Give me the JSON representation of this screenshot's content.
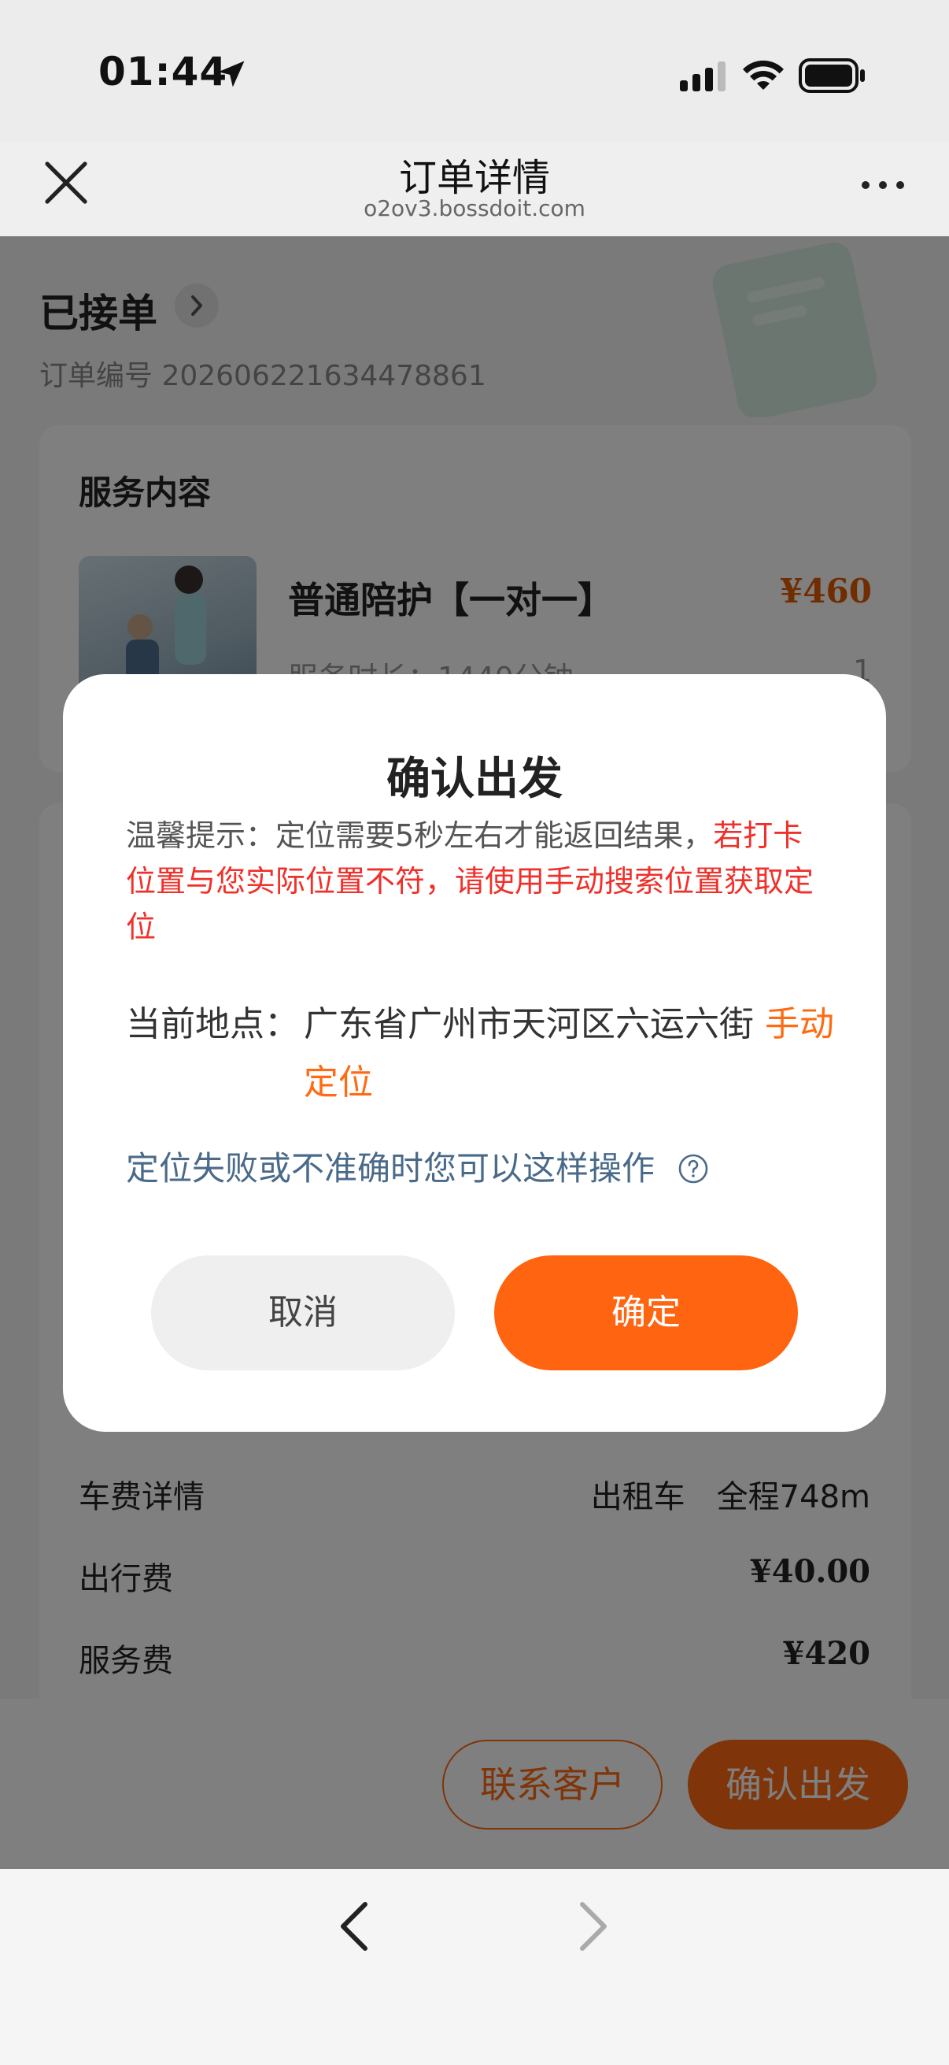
{
  "status_bar": {
    "time": "01:44"
  },
  "nav": {
    "title": "订单详情",
    "subtitle": "o2ov3.bossdoit.com"
  },
  "order": {
    "status": "已接单",
    "order_number": "订单编号 202606221634478861"
  },
  "service_card": {
    "heading": "服务内容",
    "name": "普通陪护【一对一】",
    "price": "¥460",
    "duration": "服务时长：1440分钟",
    "qty": "1"
  },
  "fees": {
    "rows": [
      {
        "label": "车费详情",
        "value": "出租车　全程748m"
      },
      {
        "label": "出行费",
        "value": "¥40.00"
      },
      {
        "label": "服务费",
        "value": "¥420"
      }
    ]
  },
  "actions": {
    "contact": "联系客户",
    "depart": "确认出发"
  },
  "modal": {
    "title": "确认出发",
    "tip_prefix": "温馨提示：定位需要5秒左右才能返回结果，",
    "tip_warning": "若打卡位置与您实际位置不符，请使用手动搜索位置获取定位",
    "location_label": "当前地点：",
    "location_value": "广东省广州市天河区六运六街",
    "manual_locate": "手动定位",
    "help_text": "定位失败或不准确时您可以这样操作",
    "cancel": "取消",
    "confirm": "确定"
  },
  "colors": {
    "accent": "#ff6410",
    "warning": "#f0302a",
    "help": "#4a6a8a"
  }
}
